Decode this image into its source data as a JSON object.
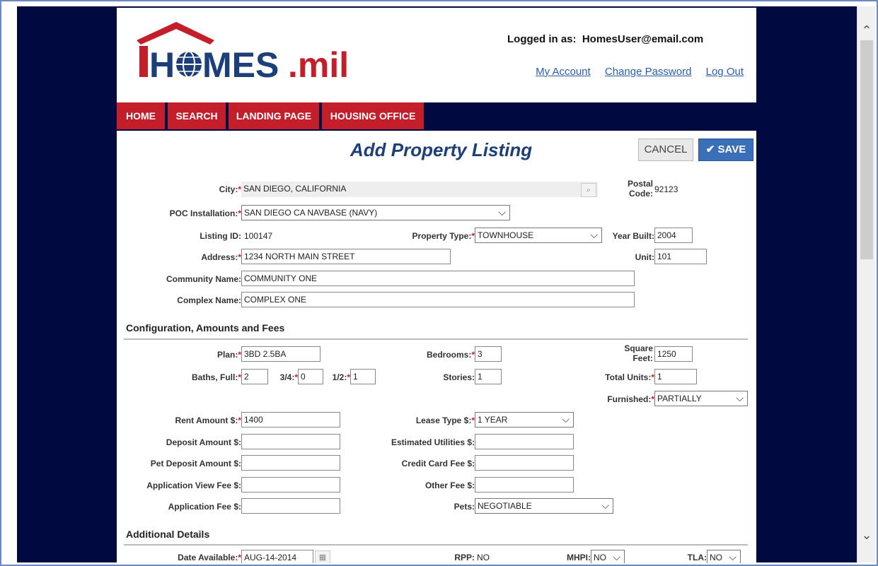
{
  "header": {
    "logo_text": "HOMES.mil",
    "login_label": "Logged in as:",
    "login_user": "HomesUser@email.com",
    "links": [
      "My Account",
      "Change Password",
      "Log Out"
    ]
  },
  "nav": [
    "HOME",
    "SEARCH",
    "LANDING PAGE",
    "HOUSING OFFICE"
  ],
  "page_title": "Add Property Listing",
  "buttons": {
    "cancel": "CANCEL",
    "save": "SAVE"
  },
  "form": {
    "city": {
      "label": "City:",
      "value": "SAN DIEGO, CALIFORNIA"
    },
    "postal_code": {
      "label_1": "Postal",
      "label_2": "Code:",
      "value": "92123"
    },
    "poc_installation": {
      "label": "POC Installation:",
      "value": "SAN DIEGO CA NAVBASE (NAVY)"
    },
    "listing_id": {
      "label": "Listing ID:",
      "value": "100147"
    },
    "property_type": {
      "label": "Property Type:",
      "value": "TOWNHOUSE"
    },
    "year_built": {
      "label": "Year Built:",
      "value": "2004"
    },
    "address": {
      "label": "Address:",
      "value": "1234 NORTH MAIN STREET"
    },
    "unit": {
      "label": "Unit:",
      "value": "101"
    },
    "community_name": {
      "label": "Community Name:",
      "value": "COMMUNITY ONE"
    },
    "complex_name": {
      "label": "Complex Name:",
      "value": "COMPLEX ONE"
    }
  },
  "config": {
    "heading": "Configuration, Amounts and Fees",
    "plan": {
      "label": "Plan:",
      "value": "3BD 2.5BA"
    },
    "bedrooms": {
      "label": "Bedrooms:",
      "value": "3"
    },
    "square_feet": {
      "label_1": "Square",
      "label_2": "Feet:",
      "value": "1250"
    },
    "baths_full": {
      "label": "Baths, Full:",
      "value": "2"
    },
    "baths_34": {
      "label": "3/4:",
      "value": "0"
    },
    "baths_12": {
      "label": "1/2:",
      "value": "1"
    },
    "stories": {
      "label": "Stories:",
      "value": "1"
    },
    "total_units": {
      "label": "Total Units:",
      "value": "1"
    },
    "furnished": {
      "label": "Furnished:",
      "value": "PARTIALLY"
    },
    "rent_amount": {
      "label": "Rent Amount $:",
      "value": "1400"
    },
    "lease_type": {
      "label": "Lease Type $:",
      "value": "1 YEAR"
    },
    "deposit_amount": {
      "label": "Deposit Amount $:",
      "value": ""
    },
    "estimated_utilities": {
      "label": "Estimated Utilities $:",
      "value": ""
    },
    "pet_deposit": {
      "label": "Pet Deposit Amount $:",
      "value": ""
    },
    "credit_card_fee": {
      "label": "Credit Card Fee $:",
      "value": ""
    },
    "application_view_fee": {
      "label": "Application View Fee $:",
      "value": ""
    },
    "other_fee": {
      "label": "Other Fee $:",
      "value": ""
    },
    "application_fee": {
      "label": "Application Fee $:",
      "value": ""
    },
    "pets": {
      "label": "Pets:",
      "value": "NEGOTIABLE"
    }
  },
  "additional": {
    "heading": "Additional Details",
    "date_available": {
      "label": "Date Available:",
      "value": "AUG-14-2014"
    },
    "rpp": {
      "label": "RPP:",
      "value": "NO"
    },
    "mhpi": {
      "label": "MHPI:",
      "value": "NO"
    },
    "tla": {
      "label": "TLA:",
      "value": "NO"
    }
  },
  "colors": {
    "nav_red": "#c41e2b",
    "navy": "#000a40",
    "title_blue": "#1c3f7a",
    "save_blue": "#3b6fb8"
  }
}
